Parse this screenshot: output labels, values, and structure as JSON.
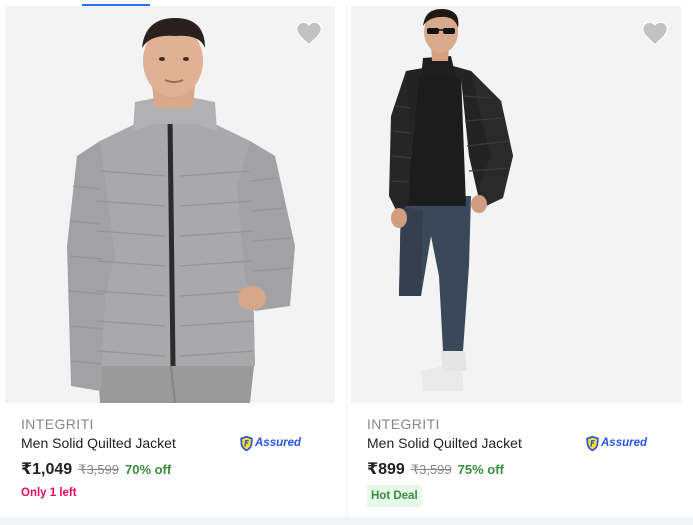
{
  "colors": {
    "brand_text": "#878787",
    "title_text": "#212121",
    "discount_green": "#388e3c",
    "stock_pink": "#e00b5d",
    "assured_blue": "#2a55e5",
    "wishlist_grey": "#c2c2c2",
    "hot_deal_bg": "#e7f8ec"
  },
  "products": [
    {
      "brand": "INTEGRITI",
      "title": "Men Solid Quilted Jacket",
      "assured_label": "Assured",
      "price": "₹1,049",
      "mrp": "₹3,599",
      "discount": "70% off",
      "badge": "Only 1 left",
      "image_icon": "grey-quilted-jacket-model",
      "wishlist_icon": "heart-icon"
    },
    {
      "brand": "INTEGRITI",
      "title": "Men Solid Quilted Jacket",
      "assured_label": "Assured",
      "price": "₹899",
      "mrp": "₹3,599",
      "discount": "75% off",
      "badge": "Hot Deal",
      "image_icon": "black-quilted-jacket-model",
      "wishlist_icon": "heart-icon"
    }
  ]
}
